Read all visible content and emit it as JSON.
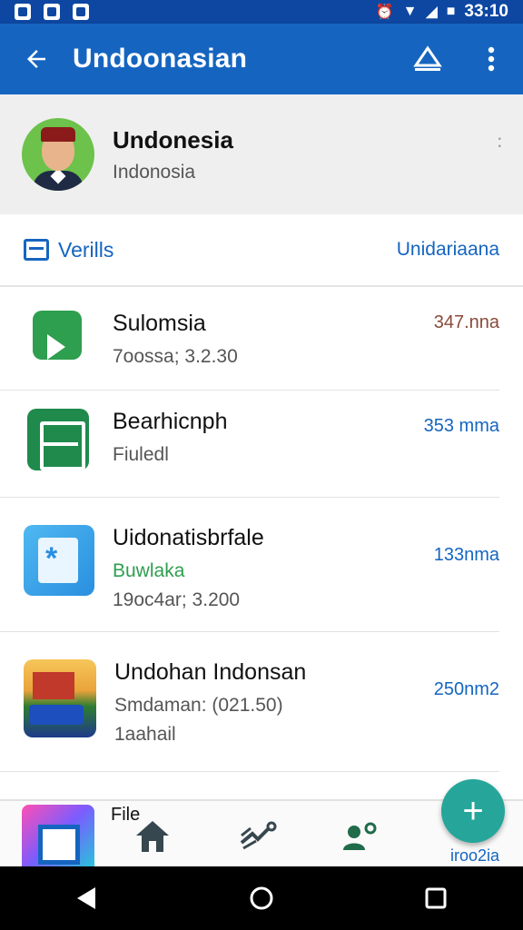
{
  "status_bar": {
    "time": "33:10"
  },
  "app_bar": {
    "title": "Undoonasian"
  },
  "profile": {
    "name": "Undonesia",
    "subtitle": "Indonosia"
  },
  "section": {
    "title": "Verills",
    "action": "Unidariaana"
  },
  "items": [
    {
      "name": "Sulomsia",
      "line2": "7oossa; 3.2.30",
      "line3": "",
      "size": "347.nna",
      "size_color": "#8a4a3a"
    },
    {
      "name": "Bearhicnph",
      "line2": "Fiuledl",
      "line3": "",
      "size": "353 mma",
      "size_color": "#1565c0"
    },
    {
      "name": "Uidonatisbrfale",
      "line2": "Buwlaka",
      "line3": "19oc4ar; 3.200",
      "size": "133nma",
      "size_color": "#1565c0"
    },
    {
      "name": "Undohan Indonsan",
      "line2": "Smdaman: (021.50)",
      "line3": "1aahail",
      "size": "250nm2",
      "size_color": "#1565c0"
    }
  ],
  "bottom_nav": {
    "file_label": "File",
    "right_label": "iroo2ia"
  },
  "fab": {
    "label": "+"
  },
  "colors": {
    "primary": "#1565c0",
    "status_bar": "#0d47a1",
    "fab": "#26a69a",
    "accent_green": "#2e9e4f"
  }
}
